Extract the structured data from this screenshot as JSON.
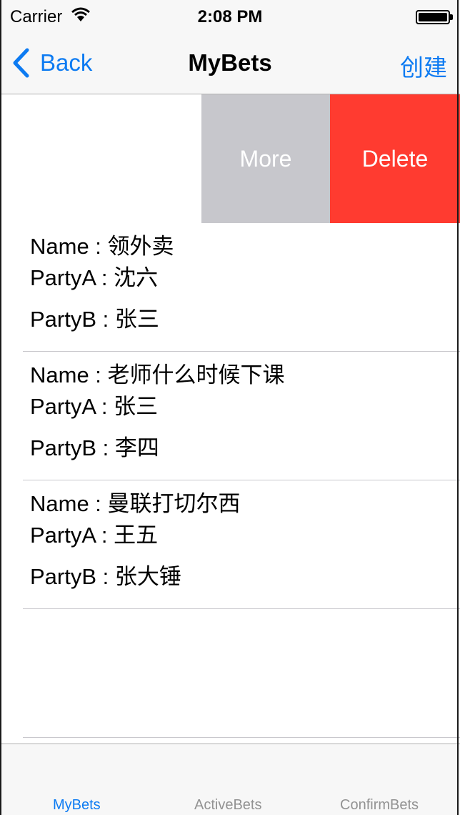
{
  "status_bar": {
    "carrier": "Carrier",
    "time": "2:08 PM",
    "battery_level": 1.0
  },
  "nav": {
    "back_label": "Back",
    "title": "MyBets",
    "create_label": "创建"
  },
  "swipe_actions": {
    "more_label": "More",
    "delete_label": "Delete"
  },
  "bets": [
    {
      "name": "Name : 领外卖",
      "party_a": "PartyA : 沈六",
      "party_b": "PartyB : 张三"
    },
    {
      "name": "Name : 老师什么时候下课",
      "party_a": "PartyA : 张三",
      "party_b": "PartyB : 李四"
    },
    {
      "name": "Name : 曼联打切尔西",
      "party_a": "PartyA : 王五",
      "party_b": "PartyB : 张大锤"
    }
  ],
  "tabs": [
    {
      "label": "MyBets",
      "active": true
    },
    {
      "label": "ActiveBets",
      "active": false
    },
    {
      "label": "ConfirmBets",
      "active": false
    }
  ],
  "colors": {
    "tint": "#0d7bf2",
    "delete": "#ff3b30",
    "more": "#c7c7cc"
  },
  "icons": [
    "wifi-icon",
    "battery-icon",
    "back-chevron-icon"
  ]
}
